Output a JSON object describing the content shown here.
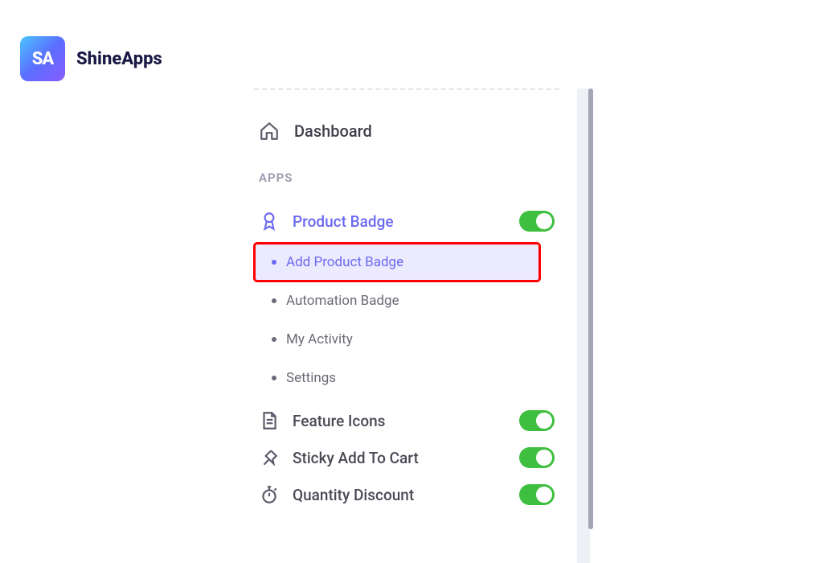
{
  "brand": {
    "logo_text": "SA",
    "name": "ShineApps"
  },
  "sidebar": {
    "dashboard_label": "Dashboard",
    "section_label": "APPS",
    "apps": [
      {
        "id": "product-badge",
        "label": "Product Badge",
        "icon": "ribbon-badge-icon",
        "accent": true,
        "toggle_on": true,
        "sub_items": [
          {
            "label": "Add Product Badge",
            "active": true,
            "highlighted": true
          },
          {
            "label": "Automation Badge",
            "active": false,
            "highlighted": false
          },
          {
            "label": "My Activity",
            "active": false,
            "highlighted": false
          },
          {
            "label": "Settings",
            "active": false,
            "highlighted": false
          }
        ]
      },
      {
        "id": "feature-icons",
        "label": "Feature Icons",
        "icon": "file-list-icon",
        "accent": false,
        "toggle_on": true
      },
      {
        "id": "sticky-add-to-cart",
        "label": "Sticky Add To Cart",
        "icon": "pin-icon",
        "accent": false,
        "toggle_on": true
      },
      {
        "id": "quantity-discount",
        "label": "Quantity Discount",
        "icon": "stopwatch-icon",
        "accent": false,
        "toggle_on": true
      }
    ]
  }
}
